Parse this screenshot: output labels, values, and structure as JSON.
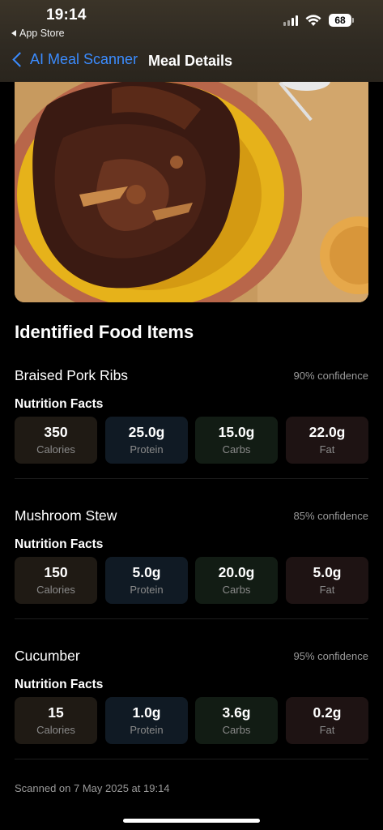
{
  "status_bar": {
    "time": "19:14",
    "back_app": "App Store",
    "battery": "68"
  },
  "nav": {
    "back_label": "AI Meal Scanner",
    "title": "Meal Details"
  },
  "section_title": "Identified Food Items",
  "nutrition_facts_label": "Nutrition Facts",
  "labels": {
    "calories": "Calories",
    "protein": "Protein",
    "carbs": "Carbs",
    "fat": "Fat"
  },
  "items": [
    {
      "name": "Braised Pork Ribs",
      "confidence": "90% confidence",
      "calories": "350",
      "protein": "25.0g",
      "carbs": "15.0g",
      "fat": "22.0g"
    },
    {
      "name": "Mushroom Stew",
      "confidence": "85% confidence",
      "calories": "150",
      "protein": "5.0g",
      "carbs": "20.0g",
      "fat": "5.0g"
    },
    {
      "name": "Cucumber",
      "confidence": "95% confidence",
      "calories": "15",
      "protein": "1.0g",
      "carbs": "3.6g",
      "fat": "0.2g"
    }
  ],
  "footer": {
    "scanned": "Scanned on 7 May 2025 at 19:14"
  },
  "colors": {
    "accent": "#3b8cff",
    "background": "#000000",
    "tile_calories": "#1f1a14",
    "tile_protein": "#101a24",
    "tile_carbs": "#121c14",
    "tile_fat": "#1e1313"
  }
}
